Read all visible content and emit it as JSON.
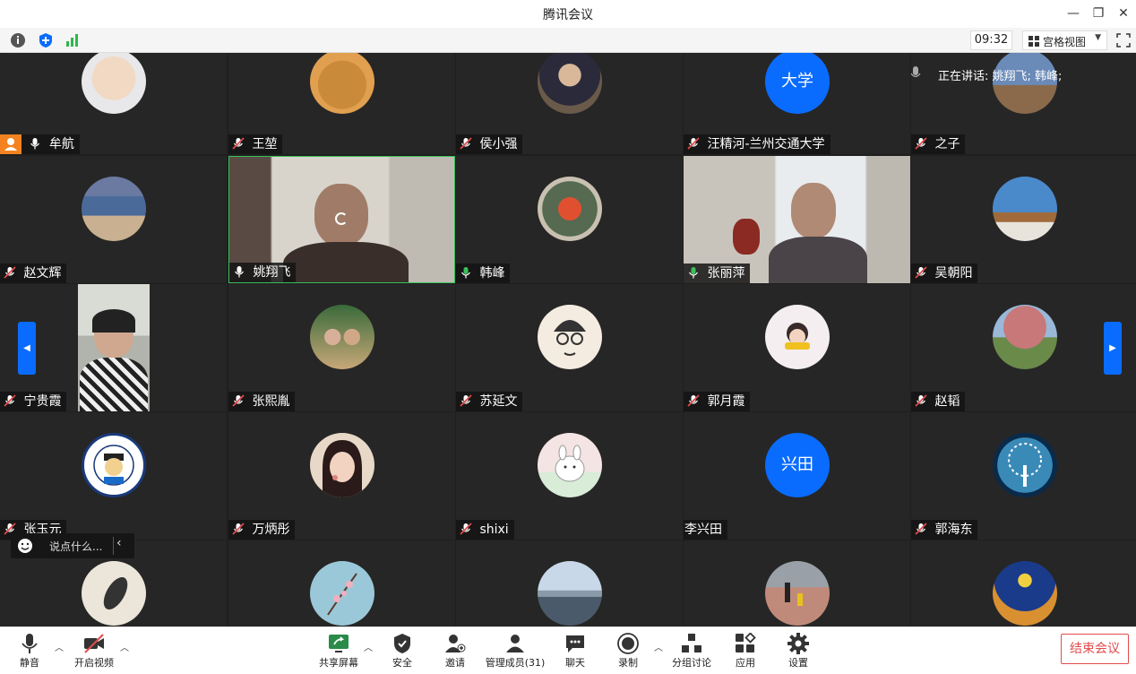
{
  "window": {
    "title": "腾讯会议",
    "controls": [
      "minimize",
      "maximize",
      "close"
    ]
  },
  "top_toolbar": {
    "time": "09:32",
    "view_label": "宫格视图"
  },
  "speaking": {
    "label": "正在讲话: 姚翔飞; 韩峰;"
  },
  "participants": [
    {
      "name": "牟航",
      "mic": "on",
      "host": true
    },
    {
      "name": "王堃",
      "mic": "muted"
    },
    {
      "name": "侯小强",
      "mic": "muted"
    },
    {
      "name": "汪精河-兰州交通大学",
      "mic": "muted",
      "avatar_text": "大学"
    },
    {
      "name": "之子",
      "mic": "muted"
    },
    {
      "name": "赵文辉",
      "mic": "muted"
    },
    {
      "name": "姚翔飞",
      "mic": "on",
      "video": true
    },
    {
      "name": "韩峰",
      "mic": "on-active"
    },
    {
      "name": "张丽萍",
      "mic": "on-active",
      "video": true
    },
    {
      "name": "吴朝阳",
      "mic": "muted"
    },
    {
      "name": "宁贵霞",
      "mic": "muted",
      "video": true
    },
    {
      "name": "张熙胤",
      "mic": "muted"
    },
    {
      "name": "苏延文",
      "mic": "muted"
    },
    {
      "name": "郭月霞",
      "mic": "muted"
    },
    {
      "name": "赵韬",
      "mic": "muted"
    },
    {
      "name": "张玉元",
      "mic": "muted"
    },
    {
      "name": "万炳彤",
      "mic": "muted"
    },
    {
      "name": "shixi",
      "mic": "muted"
    },
    {
      "name": "李兴田",
      "mic": "none",
      "avatar_text": "兴田"
    },
    {
      "name": "郭海东",
      "mic": "muted"
    }
  ],
  "chat": {
    "placeholder": "说点什么..."
  },
  "bottom_toolbar": {
    "mute": "静音",
    "video": "开启视频",
    "share": "共享屏幕",
    "security": "安全",
    "invite": "邀请",
    "members": "管理成员(31)",
    "chat": "聊天",
    "record": "录制",
    "breakout": "分组讨论",
    "apps": "应用",
    "settings": "设置",
    "end": "结束会议"
  },
  "colors": {
    "accent": "#0a6cff",
    "end_red": "#e24b4b",
    "tile_bg": "#262626",
    "mic_active": "#3cc05a",
    "host_orange": "#f58220"
  }
}
